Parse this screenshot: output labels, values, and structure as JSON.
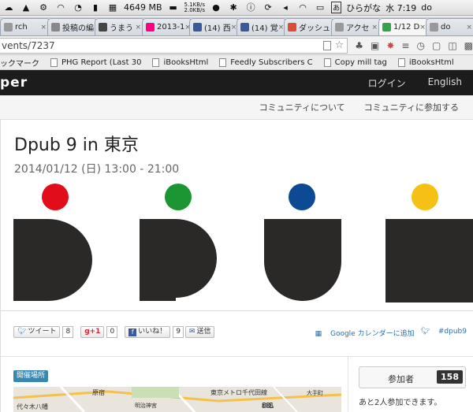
{
  "menubar": {
    "memory": "4649 MB",
    "net_up": "5.1KB/s",
    "net_down": "2.0KB/s",
    "ime": "ひらがな",
    "clock": "水 7:19",
    "user": "do"
  },
  "tabs": [
    {
      "label": "rch",
      "color": "#999999"
    },
    {
      "label": "投稿の編",
      "color": "#888888"
    },
    {
      "label": "うまう",
      "color": "#444444"
    },
    {
      "label": "2013-1",
      "color": "#ff0084"
    },
    {
      "label": "(14) 西",
      "color": "#3b5998"
    },
    {
      "label": "(14) 覚",
      "color": "#3b5998"
    },
    {
      "label": "ダッシュ",
      "color": "#dd4b39"
    },
    {
      "label": "アクセ",
      "color": "#999999"
    },
    {
      "label": "1/12 D",
      "color": "#36a24a",
      "active": true
    },
    {
      "label": "do",
      "color": "#999999"
    }
  ],
  "omnibar": {
    "url": "vents/7237"
  },
  "bookmarks": [
    "ックマーク",
    "PHG Report (Last 30",
    "iBooksHtml",
    "Feedly Subscribers C",
    "Copy mill tag",
    "iBooksHtml"
  ],
  "site": {
    "logo": "per",
    "login": "ログイン",
    "language": "English",
    "about": "コミュニティについて",
    "join": "コミュニティに参加する"
  },
  "event": {
    "title": "Dpub 9 in 東京",
    "date": "2014/01/12 (日) 13:00 - 21:00"
  },
  "banner_colors": {
    "d": "#e10d1a",
    "p": "#1b9633",
    "u": "#0c4a93",
    "b": "#f5c114",
    "letters": "#2b2828"
  },
  "social": {
    "tweet": "ツイート",
    "tweet_count": "8",
    "gplus": "g+1",
    "gplus_count": "0",
    "like": "いいね！",
    "like_count": "9",
    "send": "送信",
    "calendar": "Google カレンダーに追加",
    "hashtag": "#dpub9"
  },
  "venue": {
    "badge": "開催場所",
    "map_labels": [
      "代々木八幡",
      "原宿",
      "明治神宮",
      "東京メトロ千代田線",
      "301",
      "大手町"
    ]
  },
  "participants": {
    "label": "参加者",
    "count": "158",
    "note": "あと2人参加できます。"
  }
}
